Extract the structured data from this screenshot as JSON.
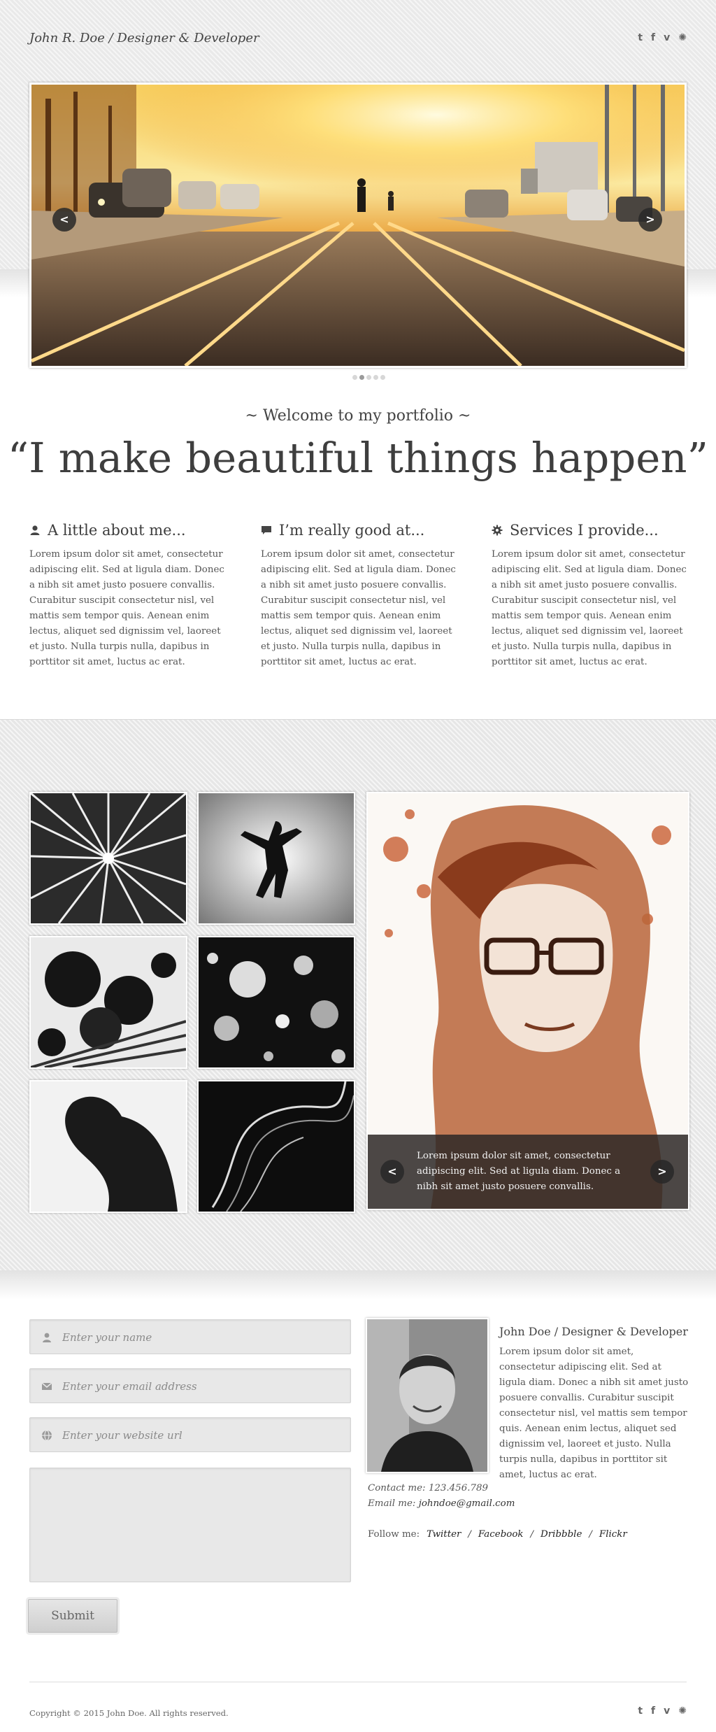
{
  "header": {
    "logo": "John R. Doe / Designer & Developer",
    "social_icons": [
      "twitter-icon",
      "facebook-icon",
      "vimeo-icon",
      "dribbble-icon"
    ],
    "social_glyphs": {
      "twitter": "t",
      "facebook": "f",
      "vimeo": "v",
      "dribbble": "✺"
    }
  },
  "slider": {
    "prev": "<",
    "next": ">",
    "dot_count": 5,
    "active_dot": 1
  },
  "intro": {
    "welcome": "~ Welcome to my portfolio ~",
    "tagline": "“I make beautiful things happen”"
  },
  "columns": [
    {
      "icon": "user-icon",
      "title": "A little about me...",
      "text": "Lorem ipsum dolor sit amet, consectetur adipiscing elit. Sed at ligula diam. Donec a nibh sit amet justo posuere convallis. Curabitur suscipit consectetur nisl, vel mattis sem tempor quis. Aenean enim lectus, aliquet sed dignissim vel, laoreet et justo. Nulla turpis nulla, dapibus in porttitor sit amet, luctus ac erat."
    },
    {
      "icon": "speech-bubble-icon",
      "title": "I’m really good at...",
      "text": "Lorem ipsum dolor sit amet, consectetur adipiscing elit. Sed at ligula diam. Donec a nibh sit amet justo posuere convallis. Curabitur suscipit consectetur nisl, vel mattis sem tempor quis. Aenean enim lectus, aliquet sed dignissim vel, laoreet et justo. Nulla turpis nulla, dapibus in porttitor sit amet, luctus ac erat."
    },
    {
      "icon": "gear-icon",
      "title": "Services I provide...",
      "text": "Lorem ipsum dolor sit amet, consectetur adipiscing elit. Sed at ligula diam. Donec a nibh sit amet justo posuere convallis. Curabitur suscipit consectetur nisl, vel mattis sem tempor quis. Aenean enim lectus, aliquet sed dignissim vel, laoreet et justo. Nulla turpis nulla, dapibus in porttitor sit amet, luctus ac erat."
    }
  ],
  "portfolio": {
    "feature_caption": "Lorem ipsum dolor sit amet, consectetur adipiscing elit. Sed at ligula diam. Donec a nibh sit amet justo posuere convallis.",
    "prev": "<",
    "next": ">"
  },
  "form": {
    "name_placeholder": "Enter your name",
    "email_placeholder": "Enter your email address",
    "website_placeholder": "Enter your website url",
    "submit": "Submit"
  },
  "profile": {
    "title": "John Doe / Designer & Developer",
    "bio": "Lorem ipsum dolor sit amet, consectetur adipiscing elit. Sed at ligula diam. Donec a nibh sit amet justo posuere convallis. Curabitur suscipit consectetur nisl, vel mattis sem tempor quis. Aenean enim lectus, aliquet sed dignissim vel, laoreet et justo. Nulla turpis nulla, dapibus in porttitor sit amet, luctus ac erat.",
    "contact_label": "Contact me:",
    "contact_value": "123.456.789",
    "email_label": "Email me:",
    "email_value": "johndoe@gmail.com",
    "follow_label": "Follow me:",
    "links": [
      "Twitter",
      "Facebook",
      "Dribbble",
      "Flickr"
    ],
    "separator": "/"
  },
  "footer": {
    "copyright": "Copyright © 2015 John Doe. All rights reserved."
  }
}
